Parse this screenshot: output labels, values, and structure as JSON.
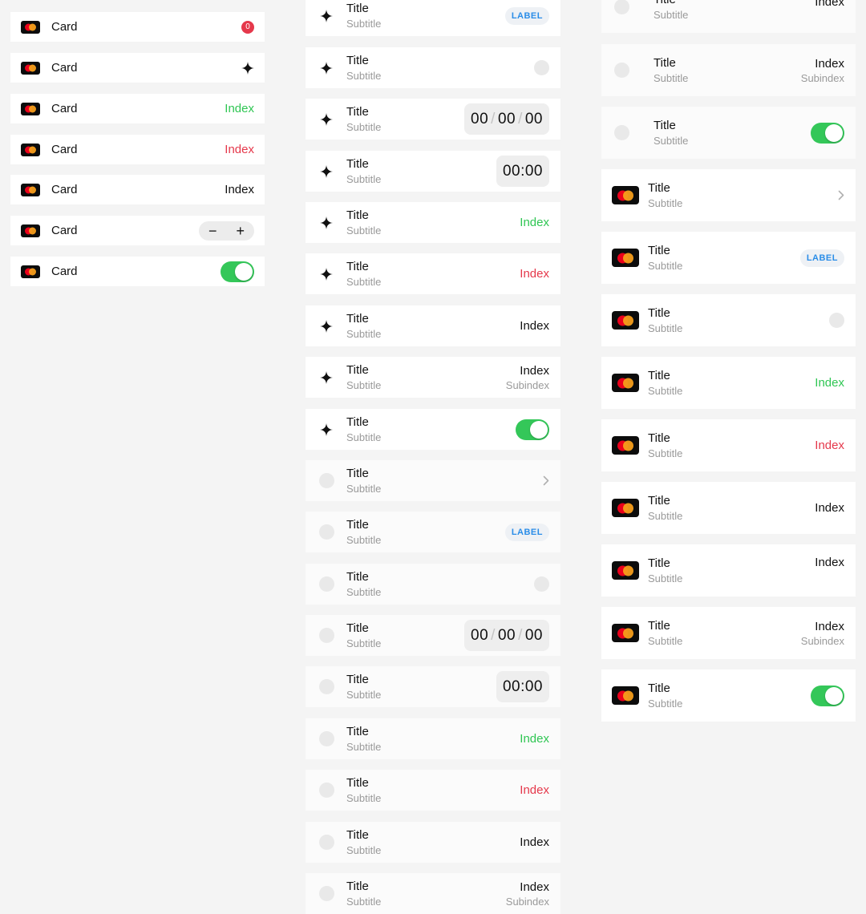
{
  "col1": {
    "rows": [
      {
        "label": "Card",
        "badge": "0"
      },
      {
        "label": "Card"
      },
      {
        "label": "Card",
        "index": "Index"
      },
      {
        "label": "Card",
        "index": "Index"
      },
      {
        "label": "Card",
        "index": "Index"
      },
      {
        "label": "Card",
        "stepper_minus": "−",
        "stepper_plus": "+"
      },
      {
        "label": "Card"
      }
    ]
  },
  "col2": {
    "rows": [
      {
        "title": "Title",
        "subtitle": "Subtitle",
        "label": "LABEL"
      },
      {
        "title": "Title",
        "subtitle": "Subtitle"
      },
      {
        "title": "Title",
        "subtitle": "Subtitle",
        "t1": "00",
        "t2": "00",
        "t3": "00",
        "sep": "/"
      },
      {
        "title": "Title",
        "subtitle": "Subtitle",
        "time": "00:00"
      },
      {
        "title": "Title",
        "subtitle": "Subtitle",
        "index": "Index"
      },
      {
        "title": "Title",
        "subtitle": "Subtitle",
        "index": "Index"
      },
      {
        "title": "Title",
        "subtitle": "Subtitle",
        "index": "Index"
      },
      {
        "title": "Title",
        "subtitle": "Subtitle",
        "index": "Index",
        "subindex": "Subindex"
      },
      {
        "title": "Title",
        "subtitle": "Subtitle"
      },
      {
        "title": "Title",
        "subtitle": "Subtitle"
      },
      {
        "title": "Title",
        "subtitle": "Subtitle",
        "label": "LABEL"
      },
      {
        "title": "Title",
        "subtitle": "Subtitle"
      },
      {
        "title": "Title",
        "subtitle": "Subtitle",
        "t1": "00",
        "t2": "00",
        "t3": "00",
        "sep": "/"
      },
      {
        "title": "Title",
        "subtitle": "Subtitle",
        "time": "00:00"
      },
      {
        "title": "Title",
        "subtitle": "Subtitle",
        "index": "Index"
      },
      {
        "title": "Title",
        "subtitle": "Subtitle",
        "index": "Index"
      },
      {
        "title": "Title",
        "subtitle": "Subtitle",
        "index": "Index"
      },
      {
        "title": "Title",
        "subtitle": "Subtitle",
        "index": "Index",
        "subindex": "Subindex"
      }
    ]
  },
  "col3": {
    "rows": [
      {
        "title": "Title",
        "subtitle": "Subtitle",
        "index": "Index"
      },
      {
        "title": "Title",
        "subtitle": "Subtitle",
        "index": "Index",
        "subindex": "Subindex"
      },
      {
        "title": "Title",
        "subtitle": "Subtitle"
      },
      {
        "title": "Title",
        "subtitle": "Subtitle"
      },
      {
        "title": "Title",
        "subtitle": "Subtitle",
        "label": "LABEL"
      },
      {
        "title": "Title",
        "subtitle": "Subtitle"
      },
      {
        "title": "Title",
        "subtitle": "Subtitle",
        "index": "Index"
      },
      {
        "title": "Title",
        "subtitle": "Subtitle",
        "index": "Index"
      },
      {
        "title": "Title",
        "subtitle": "Subtitle",
        "index": "Index"
      },
      {
        "title": "Title",
        "subtitle": "Subtitle",
        "index": "Index"
      },
      {
        "title": "Title",
        "subtitle": "Subtitle",
        "index": "Index",
        "subindex": "Subindex"
      },
      {
        "title": "Title",
        "subtitle": "Subtitle"
      }
    ]
  },
  "colors": {
    "index_green": "#2fc653",
    "index_red": "#e5384b",
    "toggle_on": "#34c759",
    "label_text": "#2a8de8",
    "badge_bg": "#e5384b"
  },
  "icons": {
    "card": "mastercard-icon",
    "sparkle": "sparkle-icon",
    "placeholder": "placeholder-dot-icon",
    "chevron": "chevron-right-icon"
  }
}
